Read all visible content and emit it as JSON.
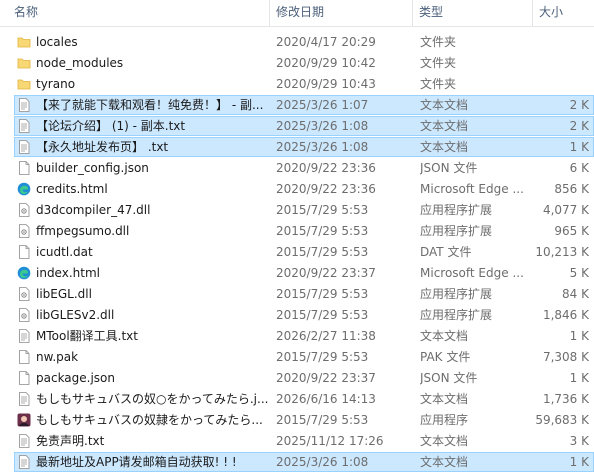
{
  "header": {
    "name": "名称",
    "date": "修改日期",
    "type": "类型",
    "size": "大小"
  },
  "files": [
    {
      "icon": "folder-icon",
      "name": "locales",
      "date": "2020/4/17 20:29",
      "type": "文件夹",
      "size": "",
      "selected": false
    },
    {
      "icon": "folder-icon",
      "name": "node_modules",
      "date": "2020/9/29 10:42",
      "type": "文件夹",
      "size": "",
      "selected": false
    },
    {
      "icon": "folder-icon",
      "name": "tyrano",
      "date": "2020/9/29 10:43",
      "type": "文件夹",
      "size": "",
      "selected": false
    },
    {
      "icon": "text-file-icon",
      "name": "【来了就能下载和观看！纯免费！】 - 副...",
      "date": "2025/3/26 1:07",
      "type": "文本文档",
      "size": "2 K",
      "selected": true
    },
    {
      "icon": "text-file-icon",
      "name": "【论坛介绍】 (1) - 副本.txt",
      "date": "2025/3/26 1:08",
      "type": "文本文档",
      "size": "2 K",
      "selected": true
    },
    {
      "icon": "text-file-icon",
      "name": "【永久地址发布页】 .txt",
      "date": "2025/3/26 1:08",
      "type": "文本文档",
      "size": "1 K",
      "selected": true
    },
    {
      "icon": "json-file-icon",
      "name": "builder_config.json",
      "date": "2020/9/22 23:36",
      "type": "JSON 文件",
      "size": "6 K",
      "selected": false
    },
    {
      "icon": "edge-icon",
      "name": "credits.html",
      "date": "2020/9/22 23:36",
      "type": "Microsoft Edge ...",
      "size": "856 K",
      "selected": false
    },
    {
      "icon": "dll-file-icon",
      "name": "d3dcompiler_47.dll",
      "date": "2015/7/29 5:53",
      "type": "应用程序扩展",
      "size": "4,077 K",
      "selected": false
    },
    {
      "icon": "dll-file-icon",
      "name": "ffmpegsumo.dll",
      "date": "2015/7/29 5:53",
      "type": "应用程序扩展",
      "size": "965 K",
      "selected": false
    },
    {
      "icon": "blank-file-icon",
      "name": "icudtl.dat",
      "date": "2015/7/29 5:53",
      "type": "DAT 文件",
      "size": "10,213 K",
      "selected": false
    },
    {
      "icon": "edge-icon",
      "name": "index.html",
      "date": "2020/9/22 23:37",
      "type": "Microsoft Edge ...",
      "size": "5 K",
      "selected": false
    },
    {
      "icon": "dll-file-icon",
      "name": "libEGL.dll",
      "date": "2015/7/29 5:53",
      "type": "应用程序扩展",
      "size": "84 K",
      "selected": false
    },
    {
      "icon": "dll-file-icon",
      "name": "libGLESv2.dll",
      "date": "2015/7/29 5:53",
      "type": "应用程序扩展",
      "size": "1,846 K",
      "selected": false
    },
    {
      "icon": "text-file-icon",
      "name": "MTool翻译工具.txt",
      "date": "2026/2/27 11:38",
      "type": "文本文档",
      "size": "1 K",
      "selected": false
    },
    {
      "icon": "blank-file-icon",
      "name": "nw.pak",
      "date": "2015/7/29 5:53",
      "type": "PAK 文件",
      "size": "7,308 K",
      "selected": false
    },
    {
      "icon": "json-file-icon",
      "name": "package.json",
      "date": "2020/9/22 23:37",
      "type": "JSON 文件",
      "size": "1 K",
      "selected": false
    },
    {
      "icon": "text-file-icon",
      "name": "もしもサキュバスの奴○をかってみたら.j...",
      "date": "2026/6/16 14:13",
      "type": "文本文档",
      "size": "1,736 K",
      "selected": false
    },
    {
      "icon": "app-icon",
      "name": "もしもサキュバスの奴隷をかってみたら...",
      "date": "2015/7/29 5:53",
      "type": "应用程序",
      "size": "59,683 K",
      "selected": false
    },
    {
      "icon": "text-file-icon",
      "name": "免责声明.txt",
      "date": "2025/11/12 17:26",
      "type": "文本文档",
      "size": "3 K",
      "selected": false
    },
    {
      "icon": "text-file-icon",
      "name": "最新地址及APP请发邮箱自动获取! ! !",
      "date": "2025/3/26 1:08",
      "type": "文本文档",
      "size": "1 K",
      "selected": true
    }
  ]
}
